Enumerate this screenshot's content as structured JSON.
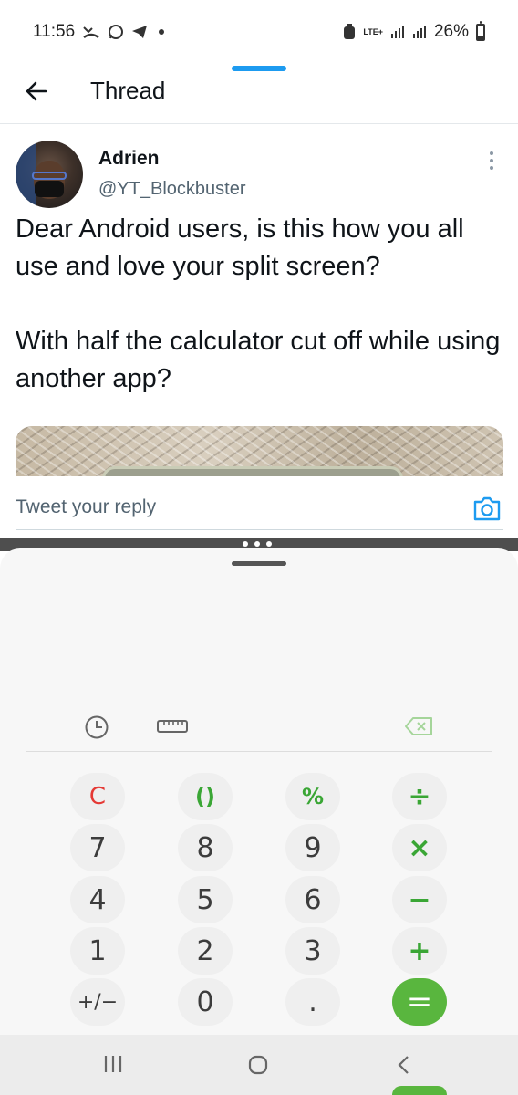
{
  "status_bar": {
    "time": "11:56",
    "battery_text": "26%",
    "network_label": "LTE+"
  },
  "header": {
    "title": "Thread"
  },
  "tweet": {
    "author_name": "Adrien",
    "author_handle": "@YT_Blockbuster",
    "text": "Dear Android users, is this how you all use and love your split screen?\n\nWith half the calculator cut off while using another app?"
  },
  "reply": {
    "placeholder": "Tweet your reply"
  },
  "calculator": {
    "keys": {
      "clear": "C",
      "parens": "()",
      "percent": "%",
      "divide": "÷",
      "seven": "7",
      "eight": "8",
      "nine": "9",
      "multiply": "×",
      "four": "4",
      "five": "5",
      "six": "6",
      "minus": "−",
      "one": "1",
      "two": "2",
      "three": "3",
      "plus": "+",
      "sign": "+/−",
      "zero": "0",
      "decimal": ".",
      "equals": "="
    }
  },
  "colors": {
    "twitter_blue": "#1d9bf0",
    "calc_green": "#3aa635",
    "calc_red": "#e53935",
    "equals_bg": "#59b63e"
  }
}
